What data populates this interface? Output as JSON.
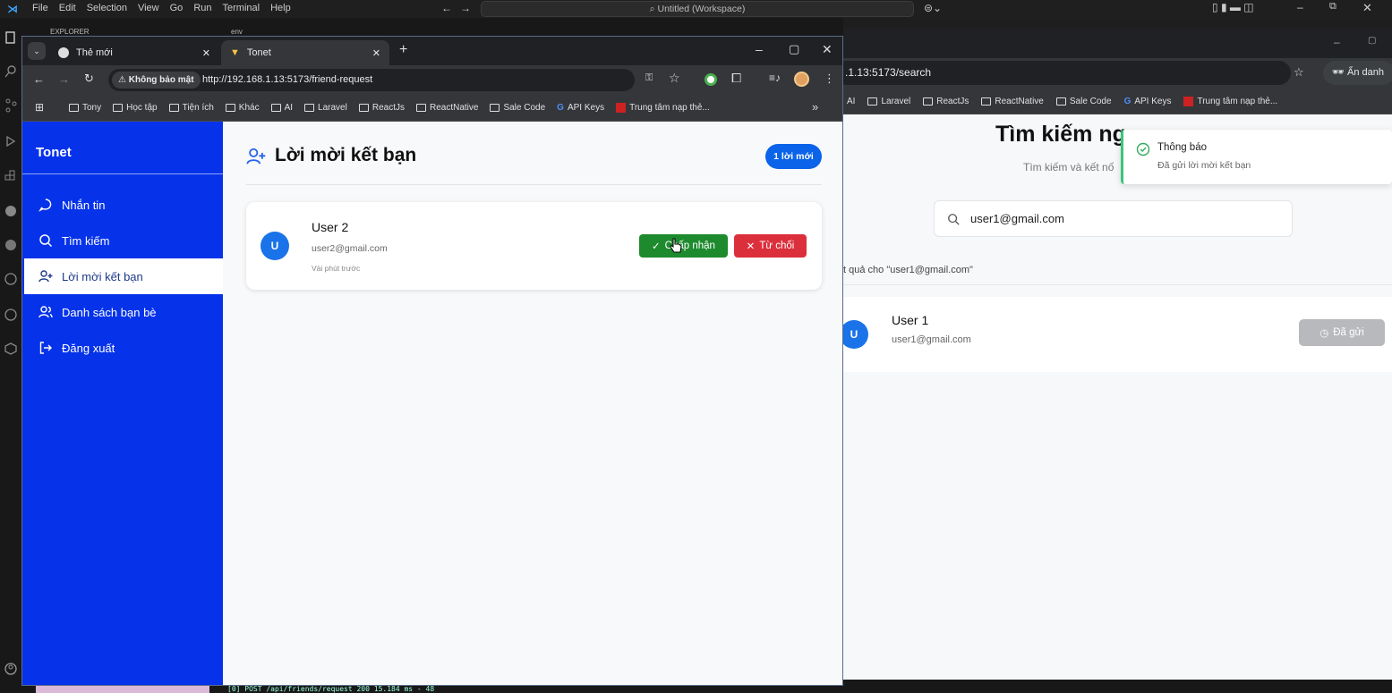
{
  "vscode": {
    "menu": [
      "File",
      "Edit",
      "Selection",
      "View",
      "Go",
      "Run",
      "Terminal",
      "Help"
    ],
    "command_center": "Untitled (Workspace)",
    "explorer_label": "EXPLORER",
    "editor_tab": "env",
    "terminal_line": "[0] POST /api/friends/request 200 15.184 ms - 48"
  },
  "left_browser": {
    "tabs": [
      {
        "title": "Thẻ mới"
      },
      {
        "title": "Tonet"
      }
    ],
    "security": "Không bảo mật",
    "url": "http://192.168.1.13:5173/friend-request",
    "bookmarks": [
      "Tony",
      "Học tập",
      "Tiện ích",
      "Khác",
      "AI",
      "Laravel",
      "ReactJs",
      "ReactNative",
      "Sale Code",
      "API Keys",
      "Trung tâm nạp thẻ..."
    ]
  },
  "app": {
    "brand": "Tonet",
    "nav": [
      {
        "label": "Nhắn tin",
        "icon": "chat-icon"
      },
      {
        "label": "Tìm kiếm",
        "icon": "search-icon"
      },
      {
        "label": "Lời mời kết bạn",
        "icon": "user-plus-icon"
      },
      {
        "label": "Danh sách bạn bè",
        "icon": "users-icon"
      },
      {
        "label": "Đăng xuất",
        "icon": "logout-icon"
      }
    ],
    "page_title": "Lời mời kết bạn",
    "badge": "1 lời mới",
    "request": {
      "avatar_letter": "U",
      "name": "User 2",
      "email": "user2@gmail.com",
      "time": "Vài phút trước",
      "accept_label": "Chấp nhận",
      "reject_label": "Từ chối"
    }
  },
  "right_browser": {
    "url_fragment": ".1.13:5173/search",
    "incognito": "Ẩn danh",
    "bookmarks": [
      "AI",
      "Laravel",
      "ReactJs",
      "ReactNative",
      "Sale Code",
      "API Keys",
      "Trung tâm nạp thẻ..."
    ],
    "title_fragment": "Tìm kiếm ng",
    "subtitle_fragment": "Tìm kiếm và kết nố",
    "search_value": "user1@gmail.com",
    "results_label": "t quả cho \"user1@gmail.com\"",
    "result": {
      "avatar_letter": "U",
      "name": "User 1",
      "email": "user1@gmail.com",
      "status_label": "Đã gửi"
    },
    "toast": {
      "title": "Thông báo",
      "message": "Đã gửi lời mời kết bạn"
    }
  },
  "colors": {
    "sidebar": "#0633ea",
    "accept": "#1e8a2e",
    "reject": "#dc2f3c",
    "badge": "#0a63e8",
    "avatar": "#1a73e8"
  }
}
